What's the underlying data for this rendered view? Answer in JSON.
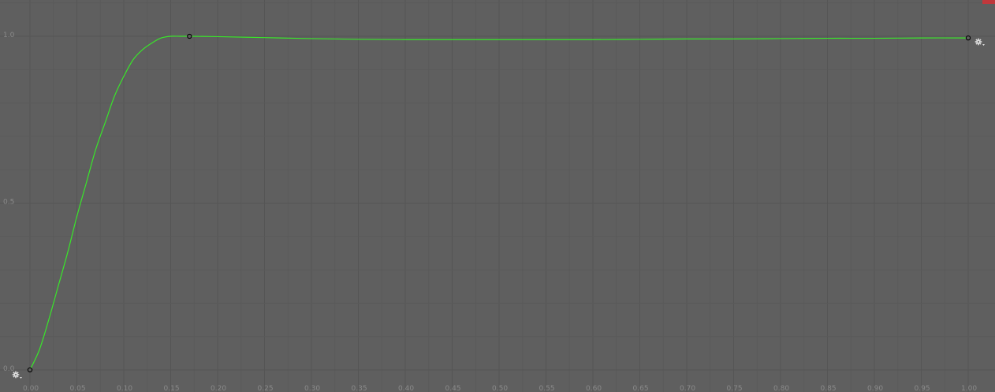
{
  "editor": {
    "title": "",
    "colors": {
      "background": "#5f5f5f",
      "grid_minor": "#5a5a5a",
      "grid_major": "#555555",
      "curve": "#39e62a",
      "key_fill": "#5f5f5f",
      "key_stroke": "#000000",
      "label": "#8a8a8a",
      "corner_accent": "#c0383c"
    },
    "gear_icons": [
      "gear-menu-icon",
      "gear-menu-icon"
    ]
  },
  "chart_data": {
    "type": "line",
    "title": "",
    "xlabel": "",
    "ylabel": "",
    "xlim": [
      0.0,
      1.0
    ],
    "ylim": [
      0.0,
      1.0
    ],
    "grid": true,
    "x_ticks": [
      "0.00",
      "0.05",
      "0.10",
      "0.15",
      "0.20",
      "0.25",
      "0.30",
      "0.35",
      "0.40",
      "0.45",
      "0.50",
      "0.55",
      "0.60",
      "0.65",
      "0.70",
      "0.75",
      "0.80",
      "0.85",
      "0.90",
      "0.95",
      "1.00"
    ],
    "y_ticks": [
      "0.0",
      "0.5",
      "1.0"
    ],
    "keyframes": [
      {
        "time": 0.0,
        "value": 0.0
      },
      {
        "time": 0.17,
        "value": 1.0
      },
      {
        "time": 1.0,
        "value": 0.995
      }
    ],
    "series": [
      {
        "x": [
          0.0,
          0.01,
          0.02,
          0.03,
          0.04,
          0.05,
          0.06,
          0.07,
          0.08,
          0.09,
          0.1,
          0.11,
          0.12,
          0.13,
          0.14,
          0.15,
          0.16,
          0.17,
          0.2,
          0.25,
          0.3,
          0.35,
          0.4,
          0.45,
          0.5,
          0.55,
          0.6,
          0.65,
          0.7,
          0.75,
          0.8,
          0.85,
          0.9,
          0.95,
          1.0
        ],
        "values": [
          0.0,
          0.06,
          0.15,
          0.25,
          0.35,
          0.46,
          0.56,
          0.66,
          0.74,
          0.82,
          0.88,
          0.93,
          0.96,
          0.98,
          0.995,
          1.0,
          1.0,
          1.0,
          0.999,
          0.996,
          0.993,
          0.991,
          0.99,
          0.99,
          0.99,
          0.99,
          0.99,
          0.991,
          0.992,
          0.992,
          0.993,
          0.994,
          0.994,
          0.995,
          0.995
        ]
      }
    ]
  }
}
